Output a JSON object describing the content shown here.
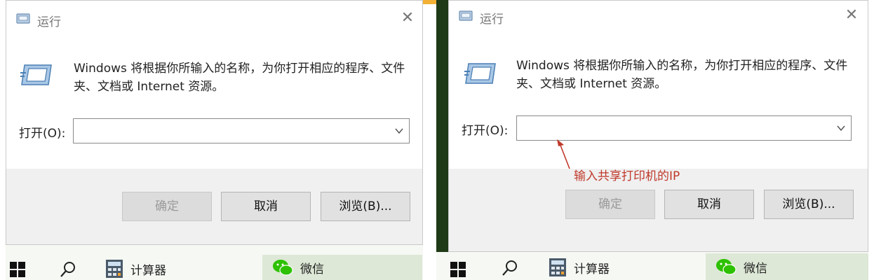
{
  "dialog": {
    "title": "运行",
    "description": "Windows 将根据你所输入的名称，为你打开相应的程序、文件夹、文档或 Internet 资源。",
    "open_label": "打开(O):",
    "open_value": "",
    "buttons": {
      "ok": "确定",
      "cancel": "取消",
      "browse": "浏览(B)..."
    }
  },
  "annotation": {
    "text": "输入共享打印机的IP",
    "color": "#c0392b"
  },
  "taskbar": {
    "apps": [
      {
        "label": "计算器",
        "icon": "calculator-icon"
      },
      {
        "label": "微信",
        "icon": "wechat-icon"
      }
    ]
  },
  "colors": {
    "dialog_bg": "#f0f0f0",
    "button_bg": "#e1e1e1",
    "desktop_green": "#1e3a16"
  }
}
